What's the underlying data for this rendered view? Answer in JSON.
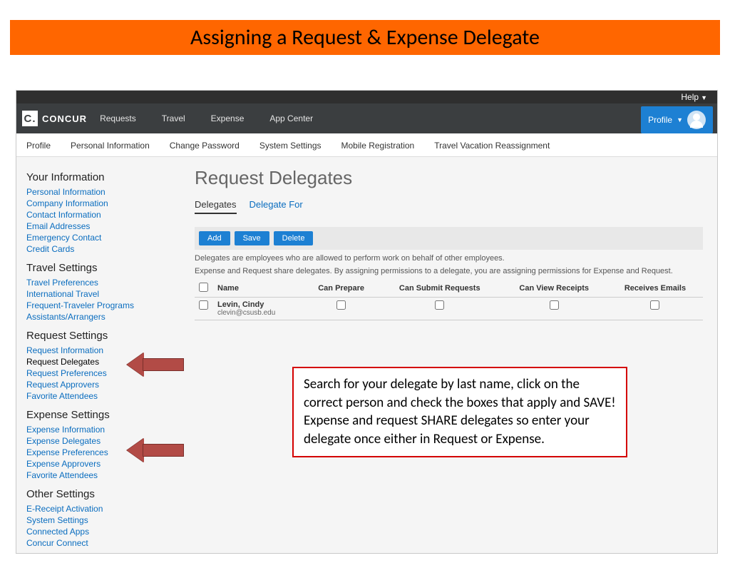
{
  "slide_title": "Assigning a Request & Expense Delegate",
  "help_label": "Help",
  "brand": "CONCUR",
  "top_nav": [
    "Requests",
    "Travel",
    "Expense",
    "App Center"
  ],
  "profile_label": "Profile",
  "sub_nav": [
    "Profile",
    "Personal Information",
    "Change Password",
    "System Settings",
    "Mobile Registration",
    "Travel Vacation Reassignment"
  ],
  "sidebar": {
    "your_info_h": "Your Information",
    "your_info": [
      "Personal Information",
      "Company Information",
      "Contact Information",
      "Email Addresses",
      "Emergency Contact",
      "Credit Cards"
    ],
    "travel_h": "Travel Settings",
    "travel": [
      "Travel Preferences",
      "International Travel",
      "Frequent-Traveler Programs",
      "Assistants/Arrangers"
    ],
    "request_h": "Request Settings",
    "request": [
      "Request Information",
      "Request Delegates",
      "Request Preferences",
      "Request Approvers",
      "Favorite Attendees"
    ],
    "expense_h": "Expense Settings",
    "expense": [
      "Expense Information",
      "Expense Delegates",
      "Expense Preferences",
      "Expense Approvers",
      "Favorite Attendees"
    ],
    "other_h": "Other Settings",
    "other": [
      "E-Receipt Activation",
      "System Settings",
      "Connected Apps",
      "Concur Connect"
    ]
  },
  "main": {
    "title": "Request Delegates",
    "tabs": {
      "delegates": "Delegates",
      "delegate_for": "Delegate For"
    },
    "buttons": {
      "add": "Add",
      "save": "Save",
      "delete": "Delete"
    },
    "help1": "Delegates are employees who are allowed to perform work on behalf of other employees.",
    "help2": "Expense and Request share delegates. By assigning permissions to a delegate, you are assigning permissions for Expense and Request.",
    "columns": {
      "name": "Name",
      "prepare": "Can Prepare",
      "submit": "Can Submit Requests",
      "receipts": "Can View Receipts",
      "emails": "Receives Emails"
    },
    "rows": [
      {
        "name": "Levin, Cindy",
        "email": "clevin@csusb.edu"
      }
    ]
  },
  "callout_text": "Search for your delegate by last name, click on the correct person and check the boxes that apply and SAVE! Expense and request SHARE delegates so enter your delegate once either in Request or Expense."
}
